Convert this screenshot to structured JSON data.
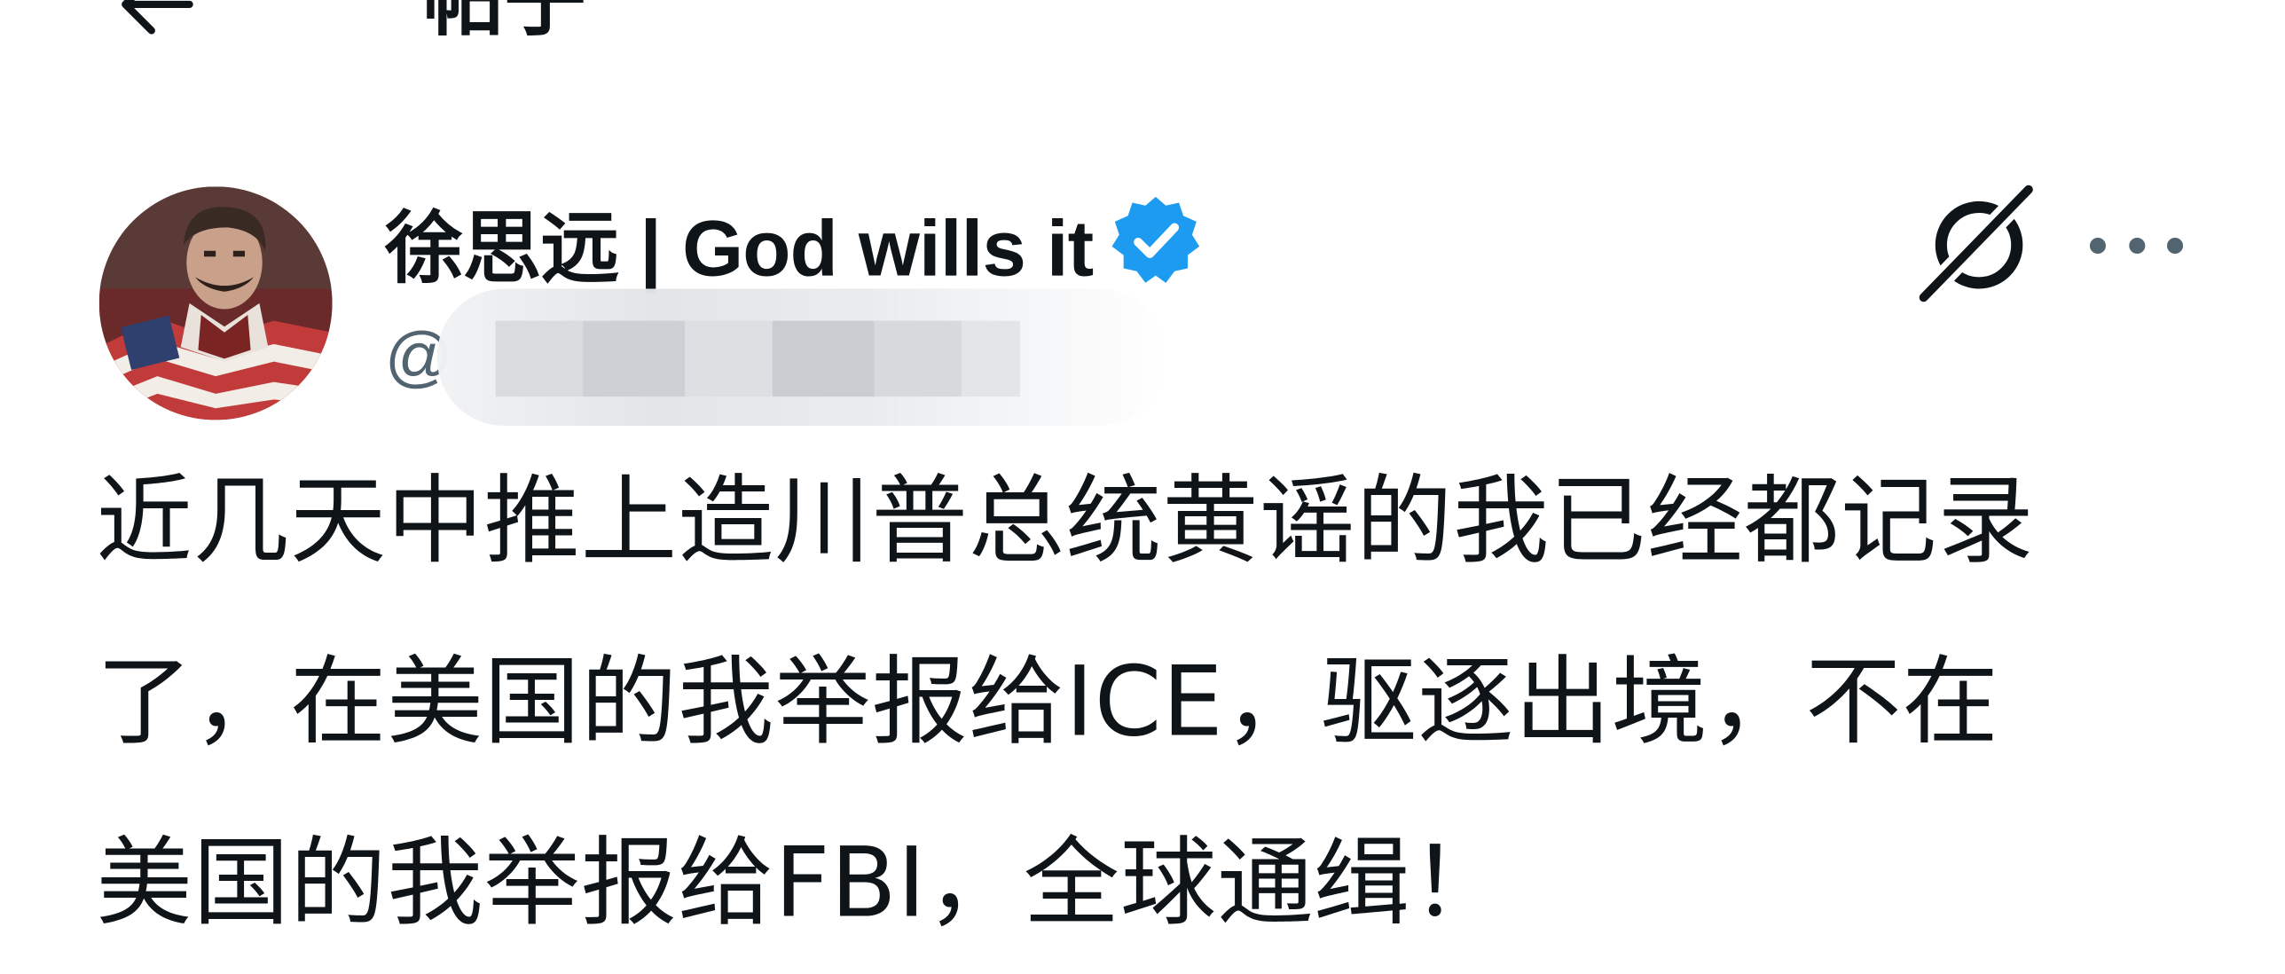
{
  "header": {
    "back_icon": "arrow-left-icon",
    "title": "帖子"
  },
  "post": {
    "author": {
      "display_name": "徐思远 | God wills it",
      "verified_icon": "verified-badge-icon",
      "verified_color": "#1d9bf0",
      "handle_prefix": "@"
    },
    "actions": {
      "grok_icon": "grok-icon",
      "more_icon": "more-horizontal-icon"
    },
    "text_lines": [
      "近几天中推上造川普总统黄谣的我已经都记录",
      "了，在美国的我举报给ICE，驱逐出境，不在",
      "美国的我举报给FBI，全球通缉！"
    ]
  },
  "colors": {
    "text_primary": "#0f1419",
    "text_secondary": "#536471",
    "accent": "#1d9bf0",
    "background": "#ffffff"
  }
}
